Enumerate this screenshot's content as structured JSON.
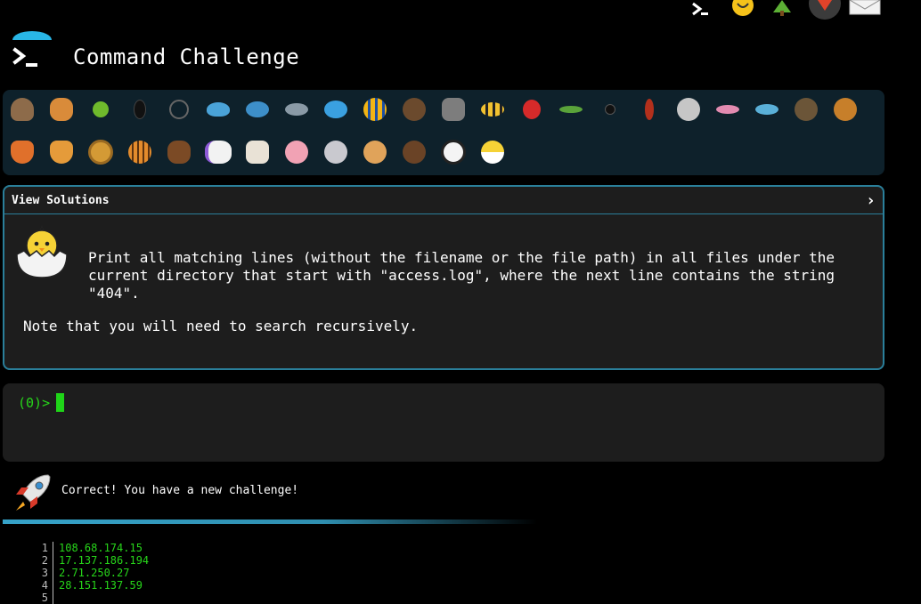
{
  "header": {
    "title": "Command Challenge",
    "logo": "terminal-prompt-icon"
  },
  "top_icons": [
    "terminal-icon",
    "lightbulb-icon",
    "tree-icon",
    "gitlab-icon",
    "mail-icon"
  ],
  "animals": [
    "snail-icon",
    "butterfly-icon",
    "caterpillar-icon",
    "ant-icon",
    "spider-web-icon",
    "whale-icon",
    "dolphin-icon",
    "shark-icon",
    "fish-icon",
    "tropical-fish-icon",
    "hedgehog-icon",
    "wolf-icon",
    "bee-icon",
    "ladybug-icon",
    "cricket-icon",
    "spider-icon",
    "scorpion-icon",
    "fly-icon",
    "worm-icon",
    "microbe-icon",
    "monkey-icon",
    "dog-icon",
    "fox-icon",
    "cat-icon",
    "lion-icon",
    "tiger-icon",
    "horse-icon",
    "unicorn-icon",
    "cow-icon",
    "pig-icon",
    "mouse-icon",
    "hamster-icon",
    "bear-icon",
    "panda-icon",
    "hatching-chick-icon"
  ],
  "challenge": {
    "header_label": "View Solutions",
    "chevron": "›",
    "description": "Print all matching lines (without the filename or the file path) in all files under the\ncurrent directory that start with \"access.log\", where the next line contains the string\n\"404\".",
    "note": "Note that you will need to search recursively."
  },
  "terminal": {
    "prompt": "(0)>"
  },
  "result": {
    "message": "Correct! You have a new challenge!",
    "progress": 0.58
  },
  "output": [
    {
      "n": "1",
      "text": "108.68.174.15"
    },
    {
      "n": "2",
      "text": "17.137.186.194"
    },
    {
      "n": "3",
      "text": "2.71.250.27"
    },
    {
      "n": "4",
      "text": "28.151.137.59"
    },
    {
      "n": "5",
      "text": ""
    }
  ]
}
